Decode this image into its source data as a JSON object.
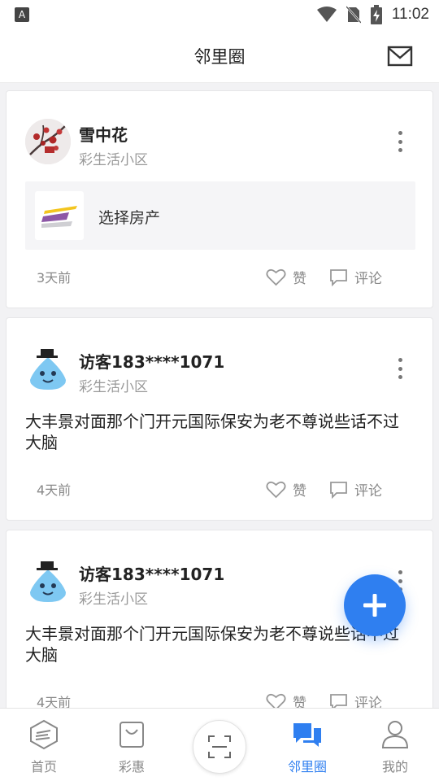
{
  "status_bar": {
    "a_badge": "A",
    "time": "11:02"
  },
  "header": {
    "title": "邻里圈",
    "mail_icon": "mail-icon"
  },
  "posts": [
    {
      "author": "雪中花",
      "community": "彩生活小区",
      "property_label": "选择房产",
      "time": "3天前",
      "like_label": "赞",
      "comment_label": "评论"
    },
    {
      "author": "访客183****1071",
      "community": "彩生活小区",
      "text": "大丰景对面那个门开元国际保安为老不尊说些话不过大脑",
      "time": "4天前",
      "like_label": "赞",
      "comment_label": "评论"
    },
    {
      "author": "访客183****1071",
      "community": "彩生活小区",
      "text": "大丰景对面那个门开元国际保安为老不尊说些话不过大脑",
      "time": "4天前",
      "like_label": "赞",
      "comment_label": "评论"
    }
  ],
  "tabs": [
    {
      "label": "首页",
      "icon": "home-icon"
    },
    {
      "label": "彩惠",
      "icon": "bag-icon"
    },
    {
      "label": "",
      "icon": "scan-icon"
    },
    {
      "label": "邻里圈",
      "icon": "chat-icon",
      "active": true
    },
    {
      "label": "我的",
      "icon": "user-icon"
    }
  ],
  "colors": {
    "accent": "#2f7ff0",
    "background": "#f2f2f4"
  }
}
